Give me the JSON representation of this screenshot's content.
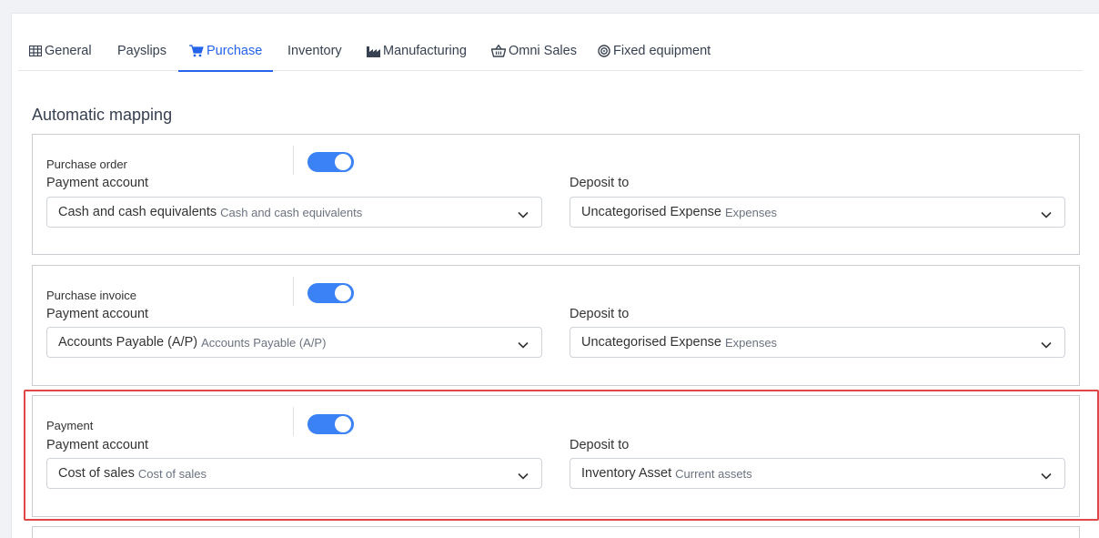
{
  "tabs": [
    {
      "label": "General",
      "icon": "table-icon",
      "active": false
    },
    {
      "label": "Payslips",
      "icon": "",
      "active": false
    },
    {
      "label": "Purchase",
      "icon": "cart-icon",
      "active": true
    },
    {
      "label": "Inventory",
      "icon": "",
      "active": false
    },
    {
      "label": "Manufacturing",
      "icon": "factory-icon",
      "active": false
    },
    {
      "label": "Omni Sales",
      "icon": "basket-icon",
      "active": false
    },
    {
      "label": "Fixed equipment",
      "icon": "target-icon",
      "active": false
    }
  ],
  "section_title": "Automatic mapping",
  "mappings": [
    {
      "name": "Purchase order",
      "enabled": true,
      "payment_label": "Payment account",
      "payment_value": "Cash and cash equivalents",
      "payment_sub": "Cash and cash equivalents",
      "deposit_label": "Deposit to",
      "deposit_value": "Uncategorised Expense",
      "deposit_sub": "Expenses"
    },
    {
      "name": "Purchase invoice",
      "enabled": true,
      "payment_label": "Payment account",
      "payment_value": "Accounts Payable (A/P)",
      "payment_sub": "Accounts Payable (A/P)",
      "deposit_label": "Deposit to",
      "deposit_value": "Uncategorised Expense",
      "deposit_sub": "Expenses"
    },
    {
      "name": "Payment",
      "enabled": true,
      "payment_label": "Payment account",
      "payment_value": "Cost of sales",
      "payment_sub": "Cost of sales",
      "deposit_label": "Deposit to",
      "deposit_value": "Inventory Asset",
      "deposit_sub": "Current assets"
    }
  ],
  "colors": {
    "accent": "#2563eb",
    "toggle_on": "#3b82f6",
    "highlight": "#e04848"
  }
}
